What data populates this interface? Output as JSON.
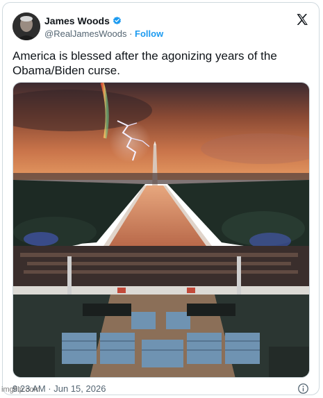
{
  "author": {
    "name": "James Woods",
    "handle": "@RealJamesWoods",
    "separator": "·",
    "follow_label": "Follow"
  },
  "tweet": {
    "text": "America is blessed after the agonizing years of the Obama/Biden curse."
  },
  "meta": {
    "timestamp": "9:23 AM · Jun 15, 2026"
  },
  "watermark": "imgflip.com",
  "colors": {
    "accent": "#1d9bf0",
    "secondary_text": "#536471",
    "border": "#cfd9de"
  },
  "icons": {
    "verified": "verified-badge-icon",
    "brand": "x-logo-icon",
    "info": "info-icon"
  }
}
